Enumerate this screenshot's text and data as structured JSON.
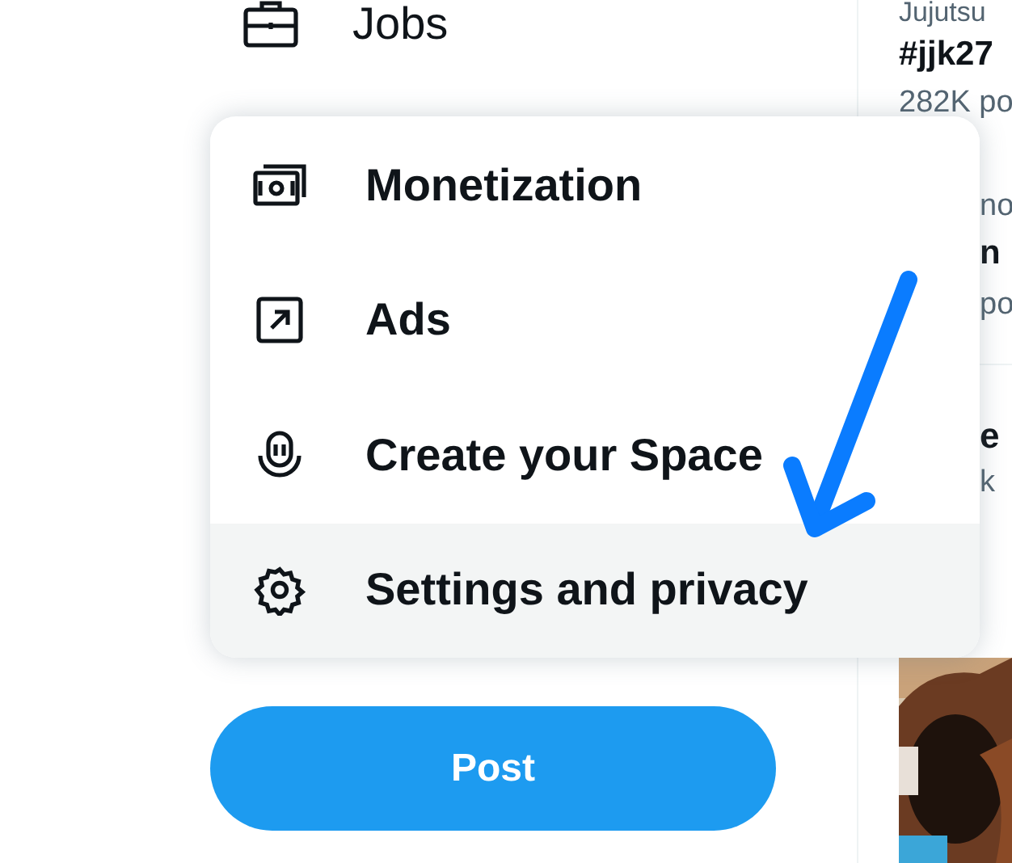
{
  "sidebar": {
    "items": [
      {
        "label": "Jobs"
      }
    ]
  },
  "menu": {
    "items": [
      {
        "label": "Monetization",
        "selected": false
      },
      {
        "label": "Ads",
        "selected": false
      },
      {
        "label": "Create your Space",
        "selected": false
      },
      {
        "label": "Settings and privacy",
        "selected": true
      }
    ]
  },
  "post_button": {
    "label": "Post"
  },
  "trends": {
    "top": [
      "Jujutsu",
      "#jjk27",
      "282K po"
    ],
    "middle": [
      "no",
      "n",
      "po"
    ],
    "bottom": [
      "e",
      "k"
    ]
  }
}
